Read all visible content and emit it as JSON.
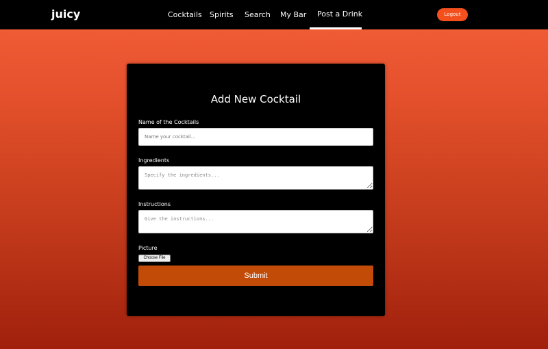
{
  "navbar": {
    "brand": "juicy",
    "links": [
      "Cocktails",
      "Spirits",
      "Search",
      "My Bar",
      "Post a Drink"
    ],
    "active": "Post a Drink",
    "logout_label": "Logout"
  },
  "form": {
    "title": "Add New Cocktail",
    "name_label": "Name of the Cocktails",
    "name_placeholder": "Name your cocktail...",
    "ingredients_label": "Ingredients",
    "ingredients_placeholder": "Specify the ingredients...",
    "instructions_label": "Instructions",
    "instructions_placeholder": "Give the instructions...",
    "picture_label": "Picture",
    "choose_file_label": "Choose File",
    "submit_label": "Submit"
  },
  "colors": {
    "accent": "#f4501e",
    "submit": "#c24b08",
    "navbar": "#000000",
    "gradient_top": "#f5603a",
    "gradient_bottom": "#a0200c"
  }
}
